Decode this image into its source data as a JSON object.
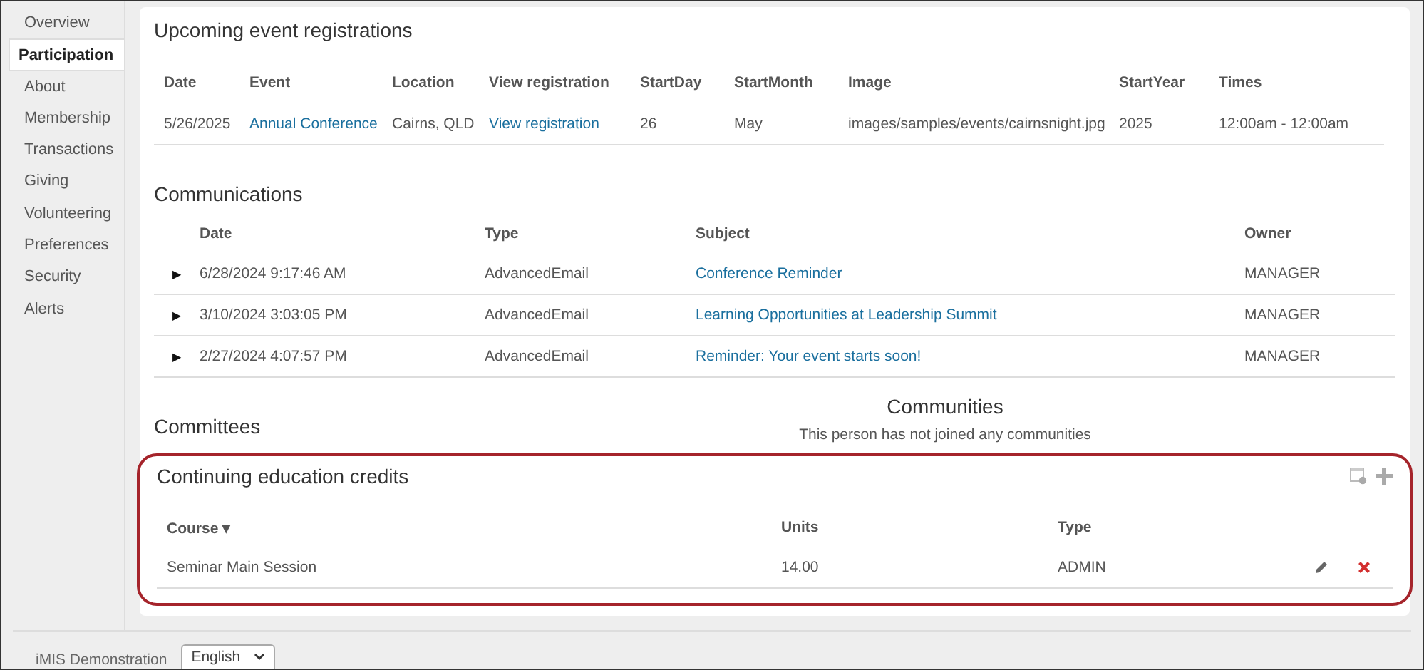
{
  "sidebar": {
    "items": [
      {
        "label": "Overview",
        "selected": false
      },
      {
        "label": "Participation",
        "selected": true
      },
      {
        "label": "About",
        "selected": false
      },
      {
        "label": "Membership",
        "selected": false
      },
      {
        "label": "Transactions",
        "selected": false
      },
      {
        "label": "Giving",
        "selected": false
      },
      {
        "label": "Volunteering",
        "selected": false
      },
      {
        "label": "Preferences",
        "selected": false
      },
      {
        "label": "Security",
        "selected": false
      },
      {
        "label": "Alerts",
        "selected": false
      }
    ]
  },
  "registrations": {
    "title": "Upcoming event registrations",
    "columns": [
      "Date",
      "Event",
      "Location",
      "View registration",
      "StartDay",
      "StartMonth",
      "Image",
      "StartYear",
      "Times"
    ],
    "rows": [
      [
        "5/26/2025",
        "Annual Conference",
        "Cairns, QLD",
        "View registration",
        "26",
        "May",
        "images/samples/events/cairnsnight.jpg",
        "2025",
        "12:00am - 12:00am"
      ]
    ]
  },
  "communications": {
    "title": "Communications",
    "columns": [
      "Date",
      "Type",
      "Subject",
      "Owner"
    ],
    "rows": [
      {
        "expander": "▶",
        "date": "6/28/2024 9:17:46 AM",
        "type": "AdvancedEmail",
        "subject": "Conference Reminder",
        "owner": "MANAGER"
      },
      {
        "expander": "▶",
        "date": "3/10/2024 3:03:05 PM",
        "type": "AdvancedEmail",
        "subject": "Learning Opportunities at Leadership Summit",
        "owner": "MANAGER"
      },
      {
        "expander": "▶",
        "date": "2/27/2024 4:07:57 PM",
        "type": "AdvancedEmail",
        "subject": "Reminder: Your event starts soon!",
        "owner": "MANAGER"
      }
    ]
  },
  "committees": {
    "title": "Committees"
  },
  "communities": {
    "title": "Communities",
    "message": "This person has not joined any communities"
  },
  "education_credits": {
    "title": "Continuing education credits",
    "highlighted": true,
    "columns": [
      "Course ▾",
      "Units",
      "Type"
    ],
    "rows": [
      {
        "course": "Seminar Main Session",
        "units": "14.00",
        "type": "ADMIN"
      }
    ]
  },
  "footer": {
    "site": "iMIS Demonstration",
    "language": "English"
  }
}
